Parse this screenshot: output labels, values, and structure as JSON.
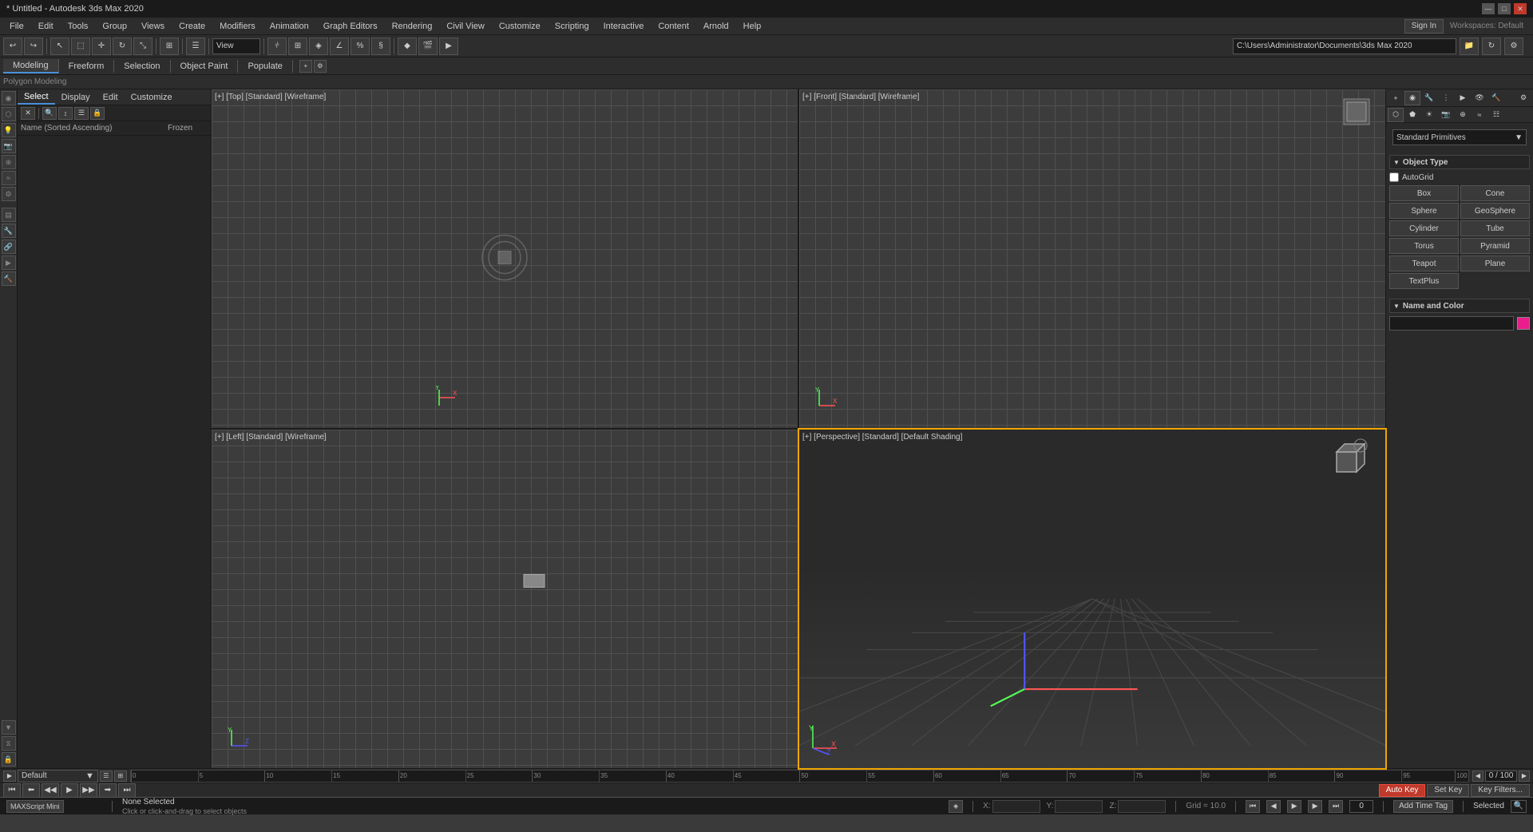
{
  "app": {
    "title": "* Untitled - Autodesk 3ds Max 2020",
    "win_controls": [
      "—",
      "□",
      "✕"
    ]
  },
  "menu": {
    "items": [
      "File",
      "Edit",
      "Tools",
      "Group",
      "Views",
      "Create",
      "Modifiers",
      "Animation",
      "Graph Editors",
      "Rendering",
      "Civil View",
      "Customize",
      "Scripting",
      "Interactive",
      "Content",
      "Arnold",
      "Help"
    ]
  },
  "toolbar": {
    "view_label": "View",
    "path": "C:\\Users\\Administrator\\Documents\\3ds Max 2020"
  },
  "sub_toolbar": {
    "tabs": [
      "Modeling",
      "Freeform",
      "Selection",
      "Object Paint",
      "Populate"
    ]
  },
  "polygon_modeling_label": "Polygon Modeling",
  "scene_explorer": {
    "tabs": [
      "Select",
      "Display",
      "Edit",
      "Customize"
    ],
    "list_headers": [
      "Name (Sorted Ascending)",
      "Frozen"
    ],
    "items": []
  },
  "viewports": {
    "top": {
      "label": "[+] [Top] [Standard] [Wireframe]",
      "active": false
    },
    "front": {
      "label": "[+] [Front] [Standard] [Wireframe]",
      "active": false
    },
    "left": {
      "label": "[+] [Left] [Standard] [Wireframe]",
      "active": false
    },
    "perspective": {
      "label": "[+] [Perspective] [Standard] [Default Shading]",
      "active": true
    }
  },
  "right_panel": {
    "dropdown_label": "Standard Primitives",
    "object_type": {
      "section_label": "Object Type",
      "autogrid_label": "AutoGrid",
      "buttons": [
        {
          "label": "Box",
          "row": 0,
          "col": 0
        },
        {
          "label": "Cone",
          "row": 0,
          "col": 1
        },
        {
          "label": "Sphere",
          "row": 1,
          "col": 0
        },
        {
          "label": "GeoSphere",
          "row": 1,
          "col": 1
        },
        {
          "label": "Cylinder",
          "row": 2,
          "col": 0
        },
        {
          "label": "Tube",
          "row": 2,
          "col": 1
        },
        {
          "label": "Torus",
          "row": 3,
          "col": 0
        },
        {
          "label": "Pyramid",
          "row": 3,
          "col": 1
        },
        {
          "label": "Teapot",
          "row": 4,
          "col": 0
        },
        {
          "label": "Plane",
          "row": 4,
          "col": 1
        },
        {
          "label": "TextPlus",
          "row": 5,
          "col": 0
        }
      ]
    },
    "name_and_color": {
      "section_label": "Name and Color",
      "name_value": "",
      "color": "#e91e8c"
    }
  },
  "bottom": {
    "track_label": "Default",
    "track_input": "",
    "frame_range": "0 / 100",
    "timeline_marks": [
      0,
      5,
      10,
      15,
      20,
      25,
      30,
      35,
      40,
      45,
      50,
      55,
      60,
      65,
      70,
      75,
      80,
      85,
      90,
      95,
      100
    ]
  },
  "status_bar": {
    "status_text": "None Selected",
    "hint_text": "Click or click-and-drag to select objects",
    "x_label": "X:",
    "y_label": "Y:",
    "z_label": "Z:",
    "x_val": "",
    "y_val": "",
    "z_val": "",
    "grid_label": "Grid = 10.0",
    "auto_key_label": "Auto Key",
    "selected_label": "Selected",
    "set_key_label": "Set Key",
    "key_filters_label": "Key Filters...",
    "add_time_tag_label": "Add Time Tag",
    "script_label": "MAXScript Mini"
  },
  "anim_controls": {
    "buttons": [
      "⏮",
      "◀",
      "◀◀",
      "▶",
      "▶▶",
      "▶⏭",
      "⏭"
    ]
  },
  "workspaces_label": "Workspaces: Default",
  "sign_in_label": "Sign In",
  "frame_number": "0"
}
